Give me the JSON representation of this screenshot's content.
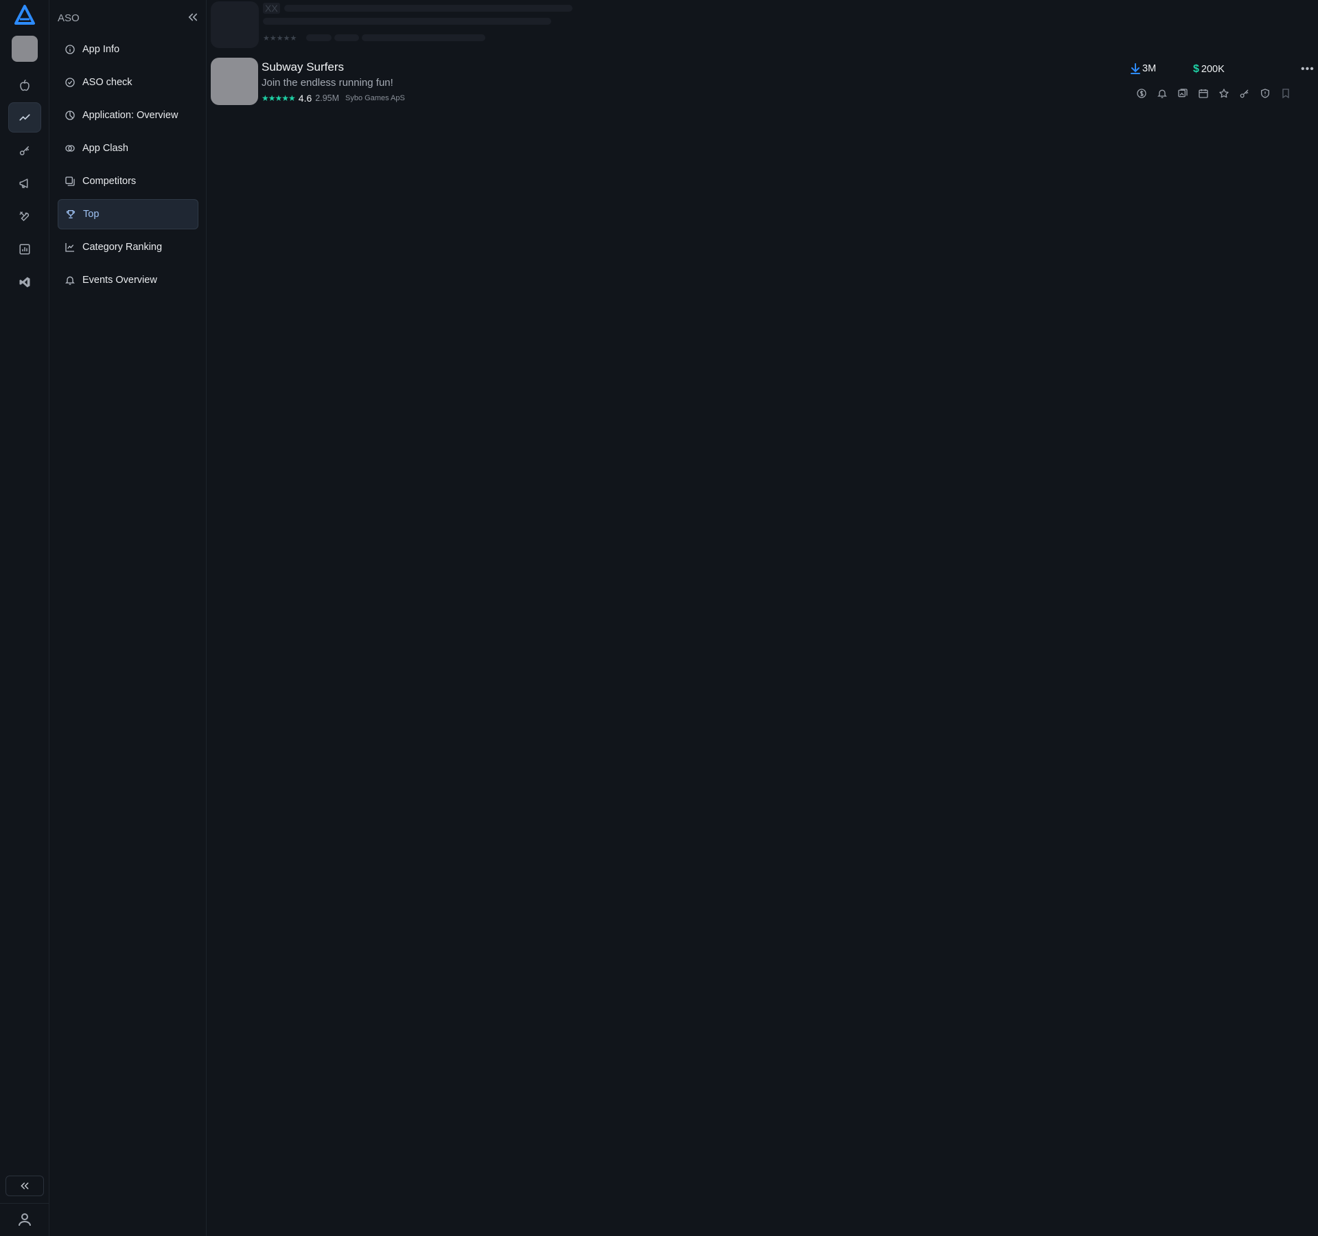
{
  "colors": {
    "background": "#11151b",
    "accent": "#2d8cff",
    "rating_green": "#1fd1a6",
    "active_text": "#9ec1f2"
  },
  "rail": {
    "icons": [
      "logo-icon",
      "apple-icon",
      "trending-icon",
      "key-icon",
      "megaphone-icon",
      "tools-icon",
      "bar-chart-icon",
      "vscode-icon"
    ],
    "active": "trending-icon"
  },
  "sidebar": {
    "title": "ASO",
    "items": [
      {
        "label": "App Info",
        "icon": "info-icon"
      },
      {
        "label": "ASO check",
        "icon": "check-circle-icon"
      },
      {
        "label": "Application: Overview",
        "icon": "pie-chart-icon"
      },
      {
        "label": "App Clash",
        "icon": "swords-icon"
      },
      {
        "label": "Competitors",
        "icon": "gallery-icon"
      },
      {
        "label": "Top",
        "icon": "trophy-icon",
        "active": true
      },
      {
        "label": "Category Ranking",
        "icon": "line-chart-icon"
      },
      {
        "label": "Events Overview",
        "icon": "bell-icon"
      }
    ]
  },
  "skeleton": {
    "placeholder": "XX"
  },
  "app": {
    "name": "Subway Surfers",
    "subtitle": "Join the endless running fun!",
    "rating": "4.6",
    "rating_value": 4.6,
    "votes": "2.95M",
    "developer": "Sybo Games ApS",
    "downloads": "3M",
    "revenue": "200K",
    "actions": [
      "dollar-circle-icon",
      "bell-icon",
      "screenshots-icon",
      "calendar-icon",
      "star-icon",
      "key-icon",
      "shield-icon",
      "bookmark-icon"
    ]
  }
}
